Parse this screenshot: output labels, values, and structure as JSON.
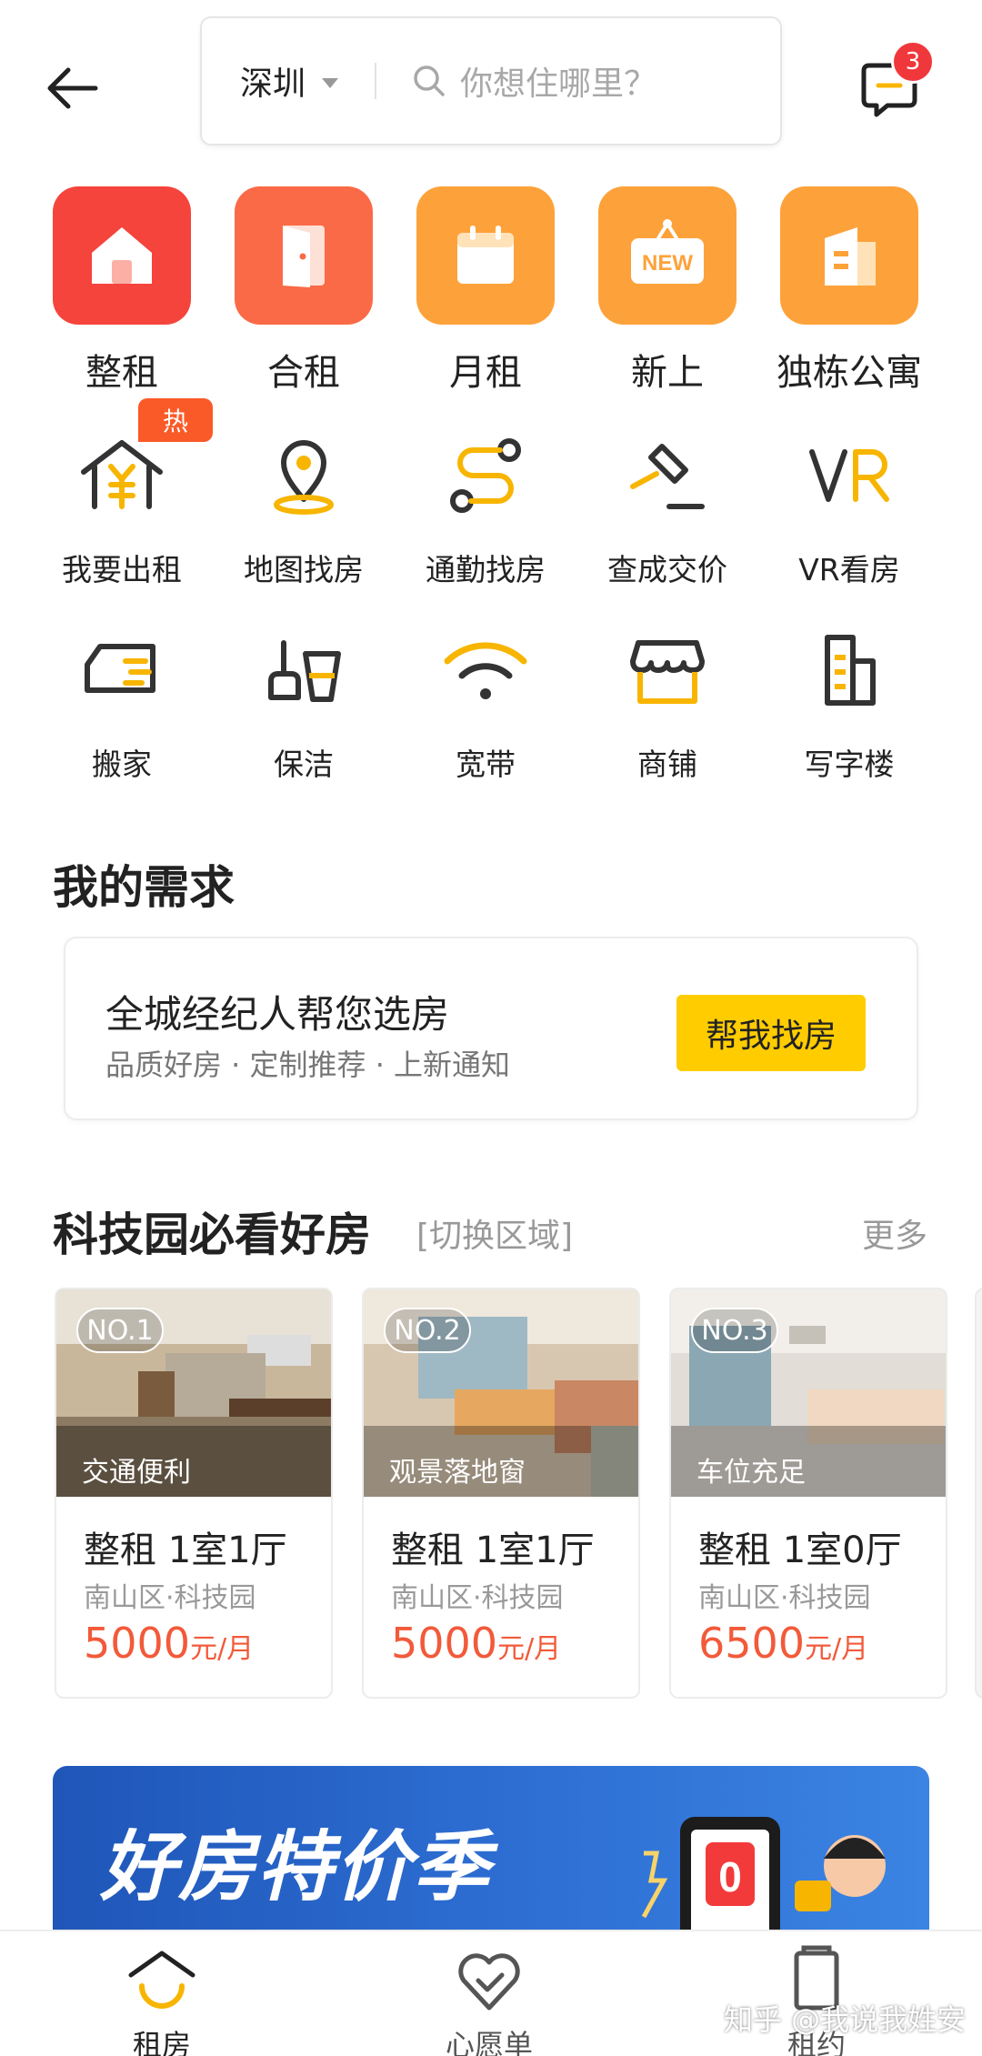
{
  "header": {
    "city": "深圳",
    "search_placeholder": "你想住哪里？",
    "message_count": "3"
  },
  "categories": [
    {
      "label": "整租",
      "icon": "home-icon",
      "color": "#f5443c"
    },
    {
      "label": "合租",
      "icon": "door-icon",
      "color": "#fa6a47"
    },
    {
      "label": "月租",
      "icon": "calendar-icon",
      "color": "#fda23a"
    },
    {
      "label": "新上",
      "icon": "new-tag-icon",
      "color": "#fda23a",
      "tag_text": "NEW"
    },
    {
      "label": "独栋公寓",
      "icon": "apartment-building-icon",
      "color": "#fda23a"
    }
  ],
  "services": [
    {
      "label": "我要出租",
      "icon": "rent-out-house-icon"
    },
    {
      "label": "地图找房",
      "icon": "map-pin-icon"
    },
    {
      "label": "通勤找房",
      "icon": "route-icon"
    },
    {
      "label": "查成交价",
      "icon": "gavel-icon"
    },
    {
      "label": "VR看房",
      "icon": "vr-icon"
    },
    {
      "label": "搬家",
      "icon": "moving-truck-icon"
    },
    {
      "label": "保洁",
      "icon": "cleaning-icon"
    },
    {
      "label": "宽带",
      "icon": "wifi-icon"
    },
    {
      "label": "商铺",
      "icon": "shop-icon"
    },
    {
      "label": "写字楼",
      "icon": "office-building-icon"
    }
  ],
  "hot_badge": "热",
  "demand": {
    "section_title": "我的需求",
    "title": "全城经纪人帮您选房",
    "subtitle": "品质好房 · 定制推荐 · 上新通知",
    "button": "帮我找房"
  },
  "featured": {
    "title": "科技园必看好房",
    "switch_area": "[切换区域]",
    "more": "更多",
    "listings": [
      {
        "rank": "NO.1",
        "tag": "交通便利",
        "title": "整租 1室1厅",
        "location": "南山区·科技园",
        "price": "5000",
        "unit": "元/月"
      },
      {
        "rank": "NO.2",
        "tag": "观景落地窗",
        "title": "整租 1室1厅",
        "location": "南山区·科技园",
        "price": "5000",
        "unit": "元/月"
      },
      {
        "rank": "NO.3",
        "tag": "车位充足",
        "title": "整租 1室0厅",
        "location": "南山区·科技园",
        "price": "6500",
        "unit": "元/月"
      }
    ]
  },
  "banner": {
    "text": "好房特价季"
  },
  "bottom_nav": [
    {
      "label": "租房",
      "icon": "home-smile-icon",
      "active": true
    },
    {
      "label": "心愿单",
      "icon": "heart-check-icon",
      "active": false
    },
    {
      "label": "租约",
      "icon": "contract-icon",
      "active": false
    }
  ],
  "watermark": "知乎 @我说我姓安",
  "colors": {
    "accent_yellow": "#ffcc00",
    "price_red": "#f25a3a",
    "badge_red": "#f0383c",
    "hot_orange": "#fa5a28",
    "icon_yellow": "#f7b500"
  }
}
